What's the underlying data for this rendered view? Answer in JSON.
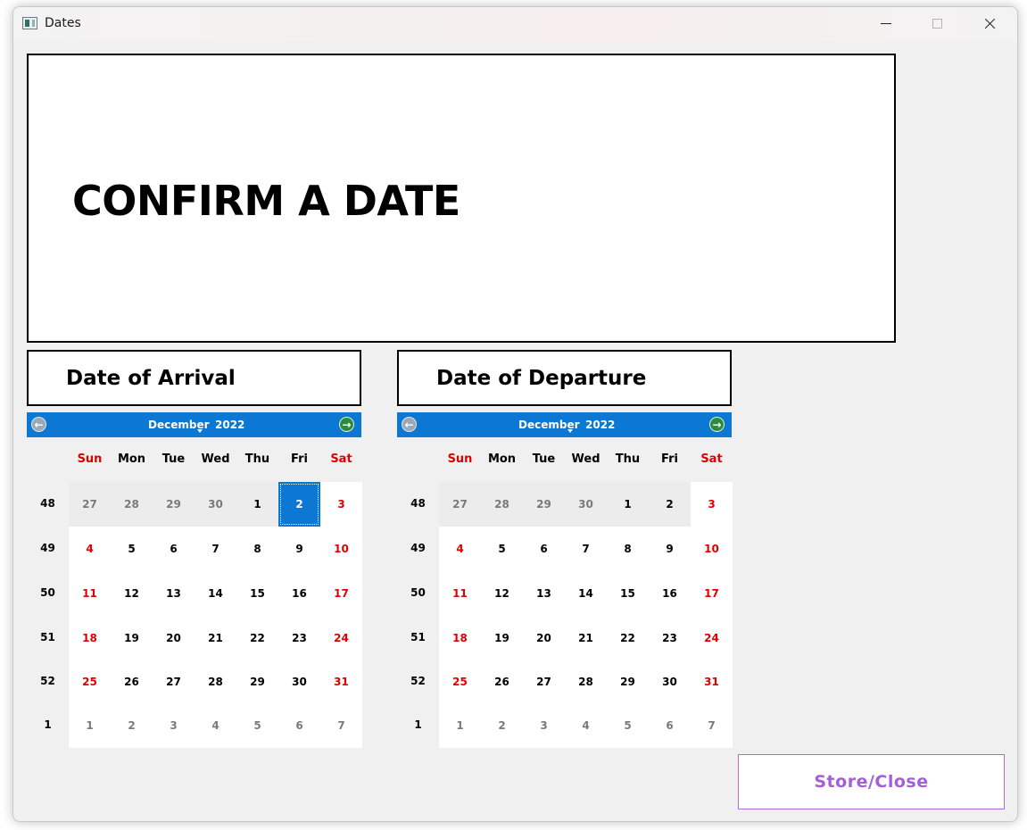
{
  "window": {
    "title": "Dates",
    "icon": "app-window-icon",
    "controls": {
      "minimize": "minimize-icon",
      "maximize": "maximize-icon",
      "close": "close-icon"
    }
  },
  "banner": {
    "text": "CONFIRM A DATE"
  },
  "arrival": {
    "label": "Date of Arrival"
  },
  "departure": {
    "label": "Date of Departure"
  },
  "calendar": {
    "month": "December",
    "year": "2022",
    "days_of_week": [
      "Sun",
      "Mon",
      "Tue",
      "Wed",
      "Thu",
      "Fri",
      "Sat"
    ],
    "week_numbers": [
      "48",
      "49",
      "50",
      "51",
      "52",
      "1"
    ],
    "weeks": [
      [
        "27",
        "28",
        "29",
        "30",
        "1",
        "2",
        "3"
      ],
      [
        "4",
        "5",
        "6",
        "7",
        "8",
        "9",
        "10"
      ],
      [
        "11",
        "12",
        "13",
        "14",
        "15",
        "16",
        "17"
      ],
      [
        "18",
        "19",
        "20",
        "21",
        "22",
        "23",
        "24"
      ],
      [
        "25",
        "26",
        "27",
        "28",
        "29",
        "30",
        "31"
      ],
      [
        "1",
        "2",
        "3",
        "4",
        "5",
        "6",
        "7"
      ]
    ],
    "colors": {
      "header": "#0d78d4",
      "weekend": "#e00000",
      "selected": "#0d78d4",
      "other_month": "#7a7a7a"
    }
  },
  "arrival_calendar": {
    "selected_day": "2"
  },
  "departure_calendar": {
    "selected_day": ""
  },
  "store_button": {
    "label": "Store/Close",
    "color": "#a45fd6"
  }
}
